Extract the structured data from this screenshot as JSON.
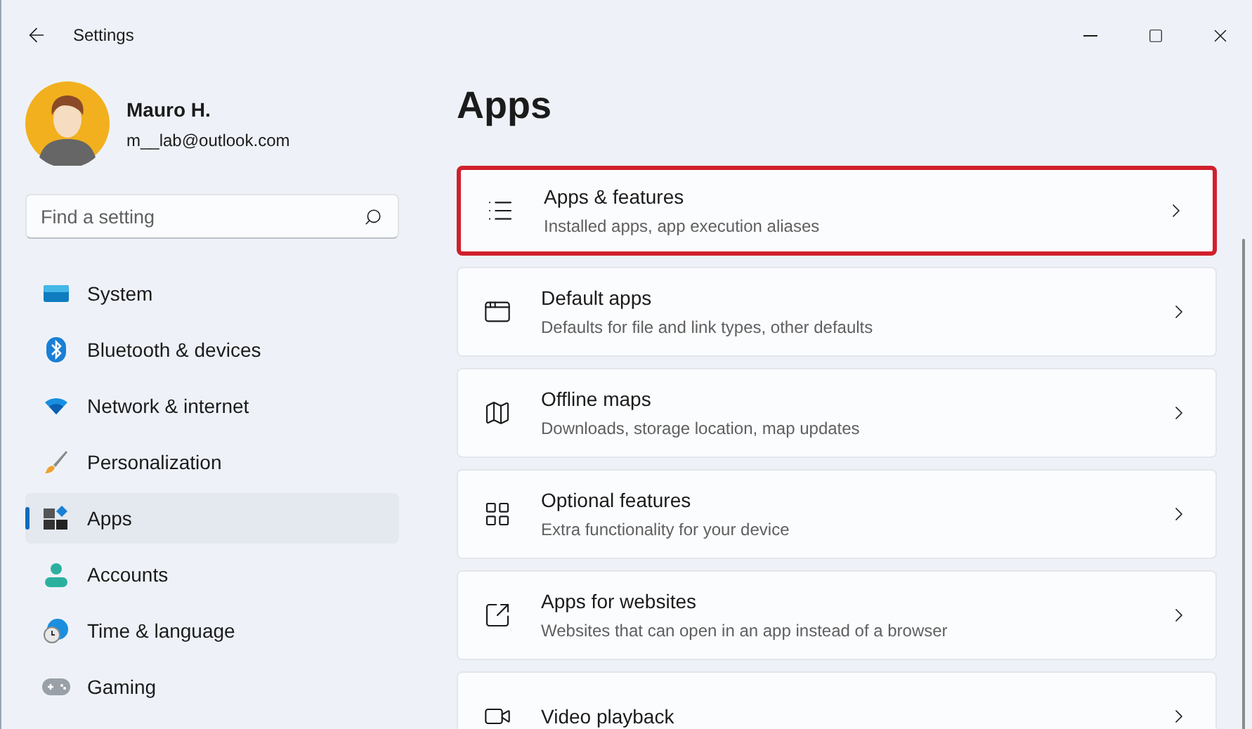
{
  "window": {
    "title": "Settings"
  },
  "profile": {
    "name": "Mauro H.",
    "email": "m__lab@outlook.com"
  },
  "search": {
    "placeholder": "Find a setting"
  },
  "nav": [
    {
      "label": "System",
      "selected": false
    },
    {
      "label": "Bluetooth & devices",
      "selected": false
    },
    {
      "label": "Network & internet",
      "selected": false
    },
    {
      "label": "Personalization",
      "selected": false
    },
    {
      "label": "Apps",
      "selected": true
    },
    {
      "label": "Accounts",
      "selected": false
    },
    {
      "label": "Time & language",
      "selected": false
    },
    {
      "label": "Gaming",
      "selected": false
    }
  ],
  "page": {
    "title": "Apps"
  },
  "cards": [
    {
      "title": "Apps & features",
      "subtitle": "Installed apps, app execution aliases",
      "highlighted": true
    },
    {
      "title": "Default apps",
      "subtitle": "Defaults for file and link types, other defaults",
      "highlighted": false
    },
    {
      "title": "Offline maps",
      "subtitle": "Downloads, storage location, map updates",
      "highlighted": false
    },
    {
      "title": "Optional features",
      "subtitle": "Extra functionality for your device",
      "highlighted": false
    },
    {
      "title": "Apps for websites",
      "subtitle": "Websites that can open in an app instead of a browser",
      "highlighted": false
    },
    {
      "title": "Video playback",
      "highlighted": false
    }
  ]
}
